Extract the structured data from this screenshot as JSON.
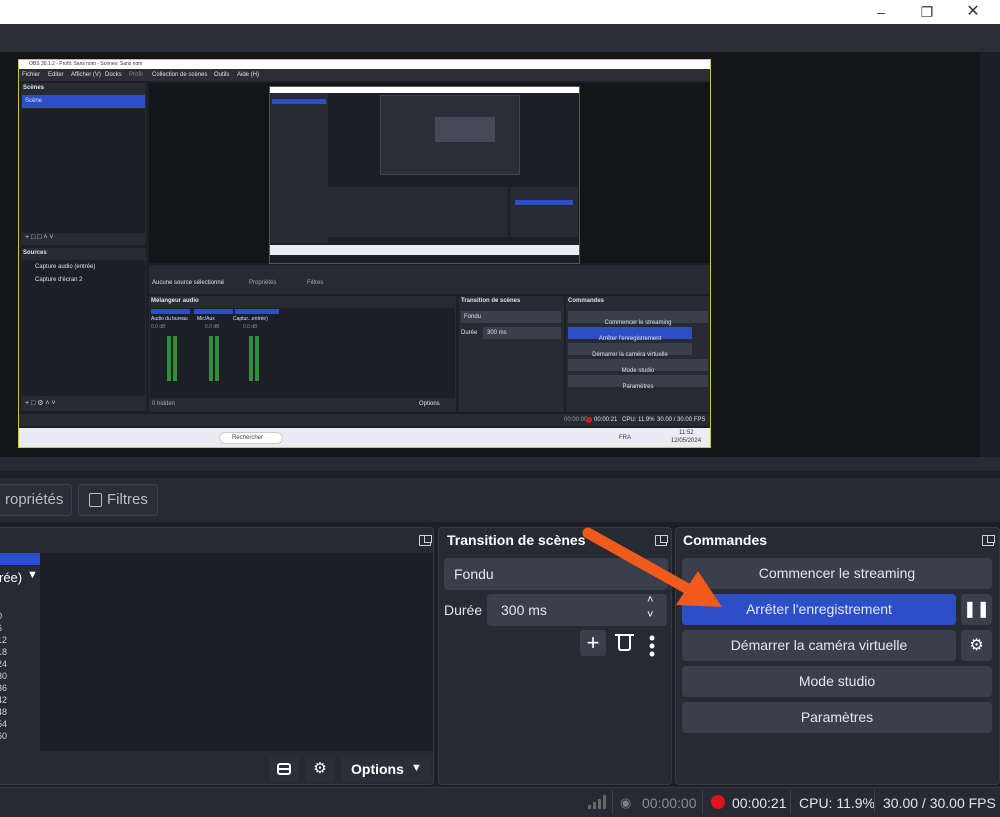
{
  "window": {
    "minimize_icon": "minimize-icon",
    "maximize_icon": "restore-icon",
    "close_icon": "close-icon"
  },
  "source_toolbar": {
    "properties_label": "ropriétés",
    "filters_label": "Filtres"
  },
  "mixer": {
    "source_label": "rée)",
    "scale": [
      "0",
      "6",
      "12",
      "18",
      "24",
      "30",
      "36",
      "42",
      "48",
      "54",
      "60"
    ],
    "options_label": "Options"
  },
  "transition": {
    "title": "Transition de scènes",
    "type_value": "Fondu",
    "duration_label": "Durée",
    "duration_value": "300 ms"
  },
  "commands": {
    "title": "Commandes",
    "start_streaming": "Commencer le streaming",
    "stop_recording": "Arrêter l'enregistrement",
    "start_virtual_cam": "Démarrer la caméra virtuelle",
    "studio_mode": "Mode studio",
    "settings": "Paramètres",
    "accent_color": "#2c4fc9"
  },
  "status": {
    "stream_time": "00:00:00",
    "rec_time": "00:00:21",
    "cpu": "CPU: 11.9%",
    "fps": "30.00 / 30.00 FPS",
    "rec_color": "#e0141e"
  },
  "annotation": {
    "arrow_color": "#f05a1a"
  },
  "inner": {
    "titlebar": "OBS 30.1.2 - Profil: Sans nom - Scènes: Sans nom",
    "menu": [
      "Fichier",
      "Editer",
      "Afficher (V)",
      "Docks",
      "Profil",
      "Collection de scènes",
      "Outils",
      "Aide (H)"
    ],
    "scenes_title": "Scènes",
    "scene_item": "Scène",
    "sources_title": "Sources",
    "sources": [
      "Capture audio (entrée)",
      "Capture d'écran 2"
    ],
    "no_source": "Aucune source sélectionné",
    "properties": "Propriétés",
    "filters": "Filtres",
    "mixer_title": "Mélangeur audio",
    "mixer_channels": [
      "Global",
      "Global",
      "Active"
    ],
    "mixer_sources": [
      "Audio du bureau",
      "Mic/Aux",
      "Captur...entrée)"
    ],
    "mixer_db": [
      "0.0 dB",
      "0.0 dB",
      "0.0 dB"
    ],
    "hidden": "0 hidden",
    "options": "Options",
    "transition_title": "Transition de scènes",
    "fondu": "Fondu",
    "duree": "Durée",
    "duree_value": "300 ms",
    "commands_title": "Commandes",
    "commands": [
      "Commencer le streaming",
      "Arrêter l'enregistrement",
      "Démarrer la caméra virtuelle",
      "Mode studio",
      "Paramètres"
    ],
    "status_stream": "00:00:00",
    "status_rec": "00:00:21",
    "status_cpu": "CPU: 11.9%",
    "status_fps": "30.00 / 30.00 FPS",
    "taskbar_search": "Rechercher",
    "taskbar_lang": "FRA",
    "taskbar_time": "11:52",
    "taskbar_date": "12/05/2024"
  }
}
